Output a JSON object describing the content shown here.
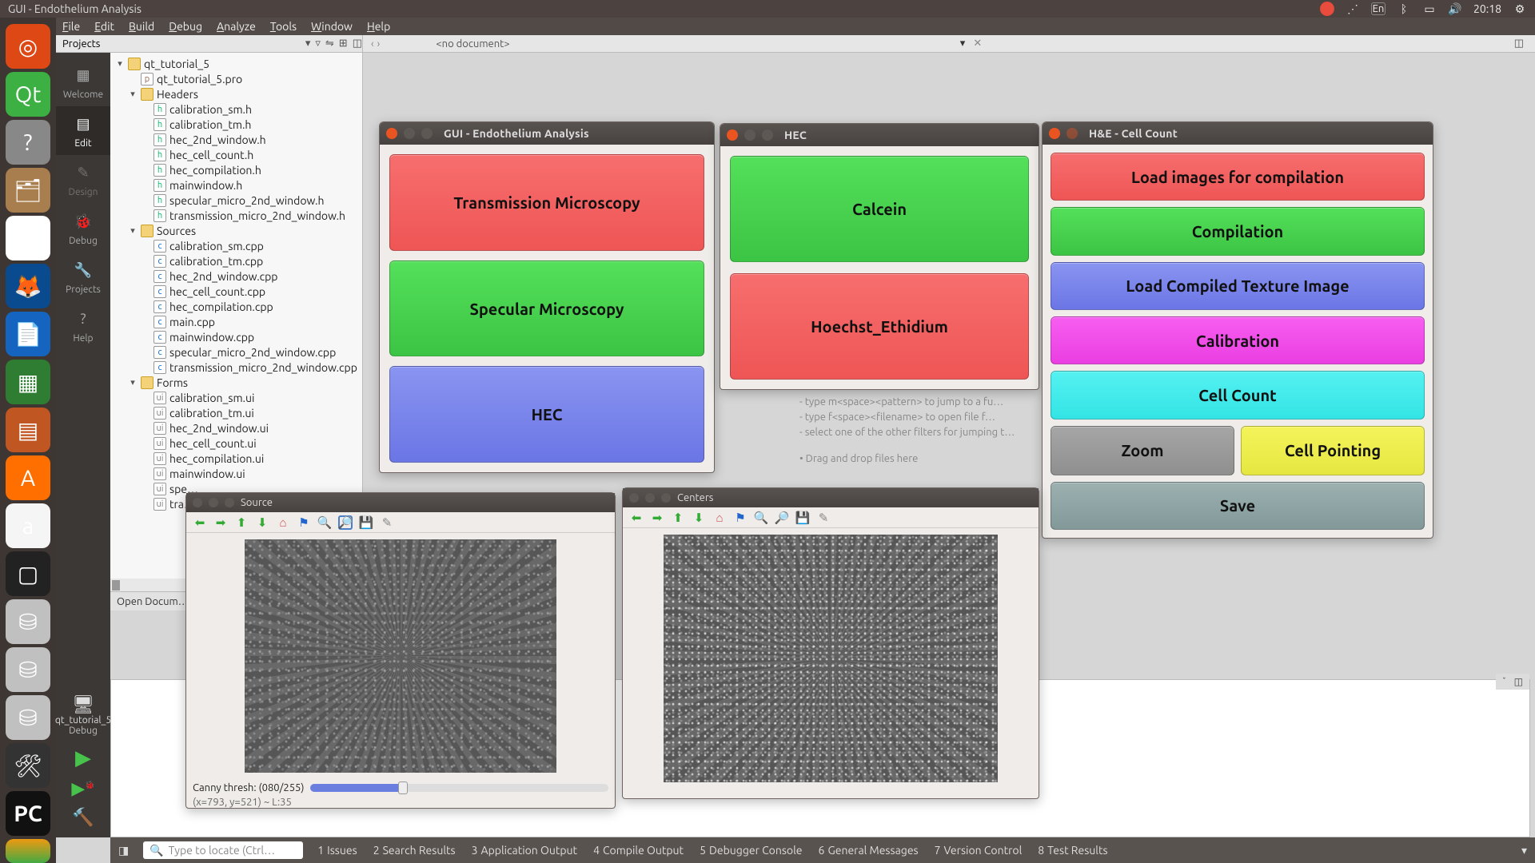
{
  "topbar": {
    "title": "GUI - Endothelium Analysis",
    "lang": "En",
    "clock": "20:18"
  },
  "appmenu": {
    "file": "File",
    "edit": "Edit",
    "build": "Build",
    "debug": "Debug",
    "analyze": "Analyze",
    "tools": "Tools",
    "window": "Window",
    "help": "Help"
  },
  "projectsrow": {
    "label": "Projects",
    "nodoc": "<no document>"
  },
  "modebar": {
    "welcome": "Welcome",
    "edit": "Edit",
    "design": "Design",
    "debug": "Debug",
    "projects": "Projects",
    "help": "Help",
    "kit1": "qt_tutorial_5",
    "kit2": "Debug"
  },
  "tree": {
    "root": "qt_tutorial_5",
    "pro": "qt_tutorial_5.pro",
    "headers_label": "Headers",
    "headers": [
      "calibration_sm.h",
      "calibration_tm.h",
      "hec_2nd_window.h",
      "hec_cell_count.h",
      "hec_compilation.h",
      "mainwindow.h",
      "specular_micro_2nd_window.h",
      "transmission_micro_2nd_window.h"
    ],
    "sources_label": "Sources",
    "sources": [
      "calibration_sm.cpp",
      "calibration_tm.cpp",
      "hec_2nd_window.cpp",
      "hec_cell_count.cpp",
      "hec_compilation.cpp",
      "main.cpp",
      "mainwindow.cpp",
      "specular_micro_2nd_window.cpp",
      "transmission_micro_2nd_window.cpp"
    ],
    "forms_label": "Forms",
    "forms": [
      "calibration_sm.ui",
      "calibration_tm.ui",
      "hec_2nd_window.ui",
      "hec_cell_count.ui",
      "hec_compilation.ui",
      "mainwindow.ui",
      "spe…",
      "tra…"
    ],
    "opendocs": "Open Docum…"
  },
  "hint": {
    "l1": "- type m<space><pattern> to jump to a fu…",
    "l2": "- type f<space><filename> to open file f…",
    "l3": "- select one of the other filters for jumping t…",
    "l4": "• Drag and drop files here"
  },
  "win_gui": {
    "title": "GUI - Endothelium Analysis",
    "btn1": "Transmission Microscopy",
    "btn2": "Specular Microscopy",
    "btn3": "HEC"
  },
  "win_hec": {
    "title": "HEC",
    "btn1": "Calcein",
    "btn2": "Hoechst_Ethidium"
  },
  "win_he": {
    "title": "H&E - Cell Count",
    "b1": "Load images for compilation",
    "b2": "Compilation",
    "b3": "Load Compiled Texture Image",
    "b4": "Calibration",
    "b5": "Cell Count",
    "b6": "Zoom",
    "b7": "Cell Pointing",
    "b8": "Save"
  },
  "win_source": {
    "title": "Source",
    "slider_label": "Canny thresh: (080/255)",
    "coords": "(x=793, y=521) ~ L:35"
  },
  "win_centers": {
    "title": "Centers"
  },
  "statusbar": {
    "placeholder": "Type to locate (Ctrl…",
    "tabs": [
      {
        "n": "1",
        "t": "Issues"
      },
      {
        "n": "2",
        "t": "Search Results"
      },
      {
        "n": "3",
        "t": "Application Output"
      },
      {
        "n": "4",
        "t": "Compile Output"
      },
      {
        "n": "5",
        "t": "Debugger Console"
      },
      {
        "n": "6",
        "t": "General Messages"
      },
      {
        "n": "7",
        "t": "Version Control"
      },
      {
        "n": "8",
        "t": "Test Results"
      }
    ]
  }
}
